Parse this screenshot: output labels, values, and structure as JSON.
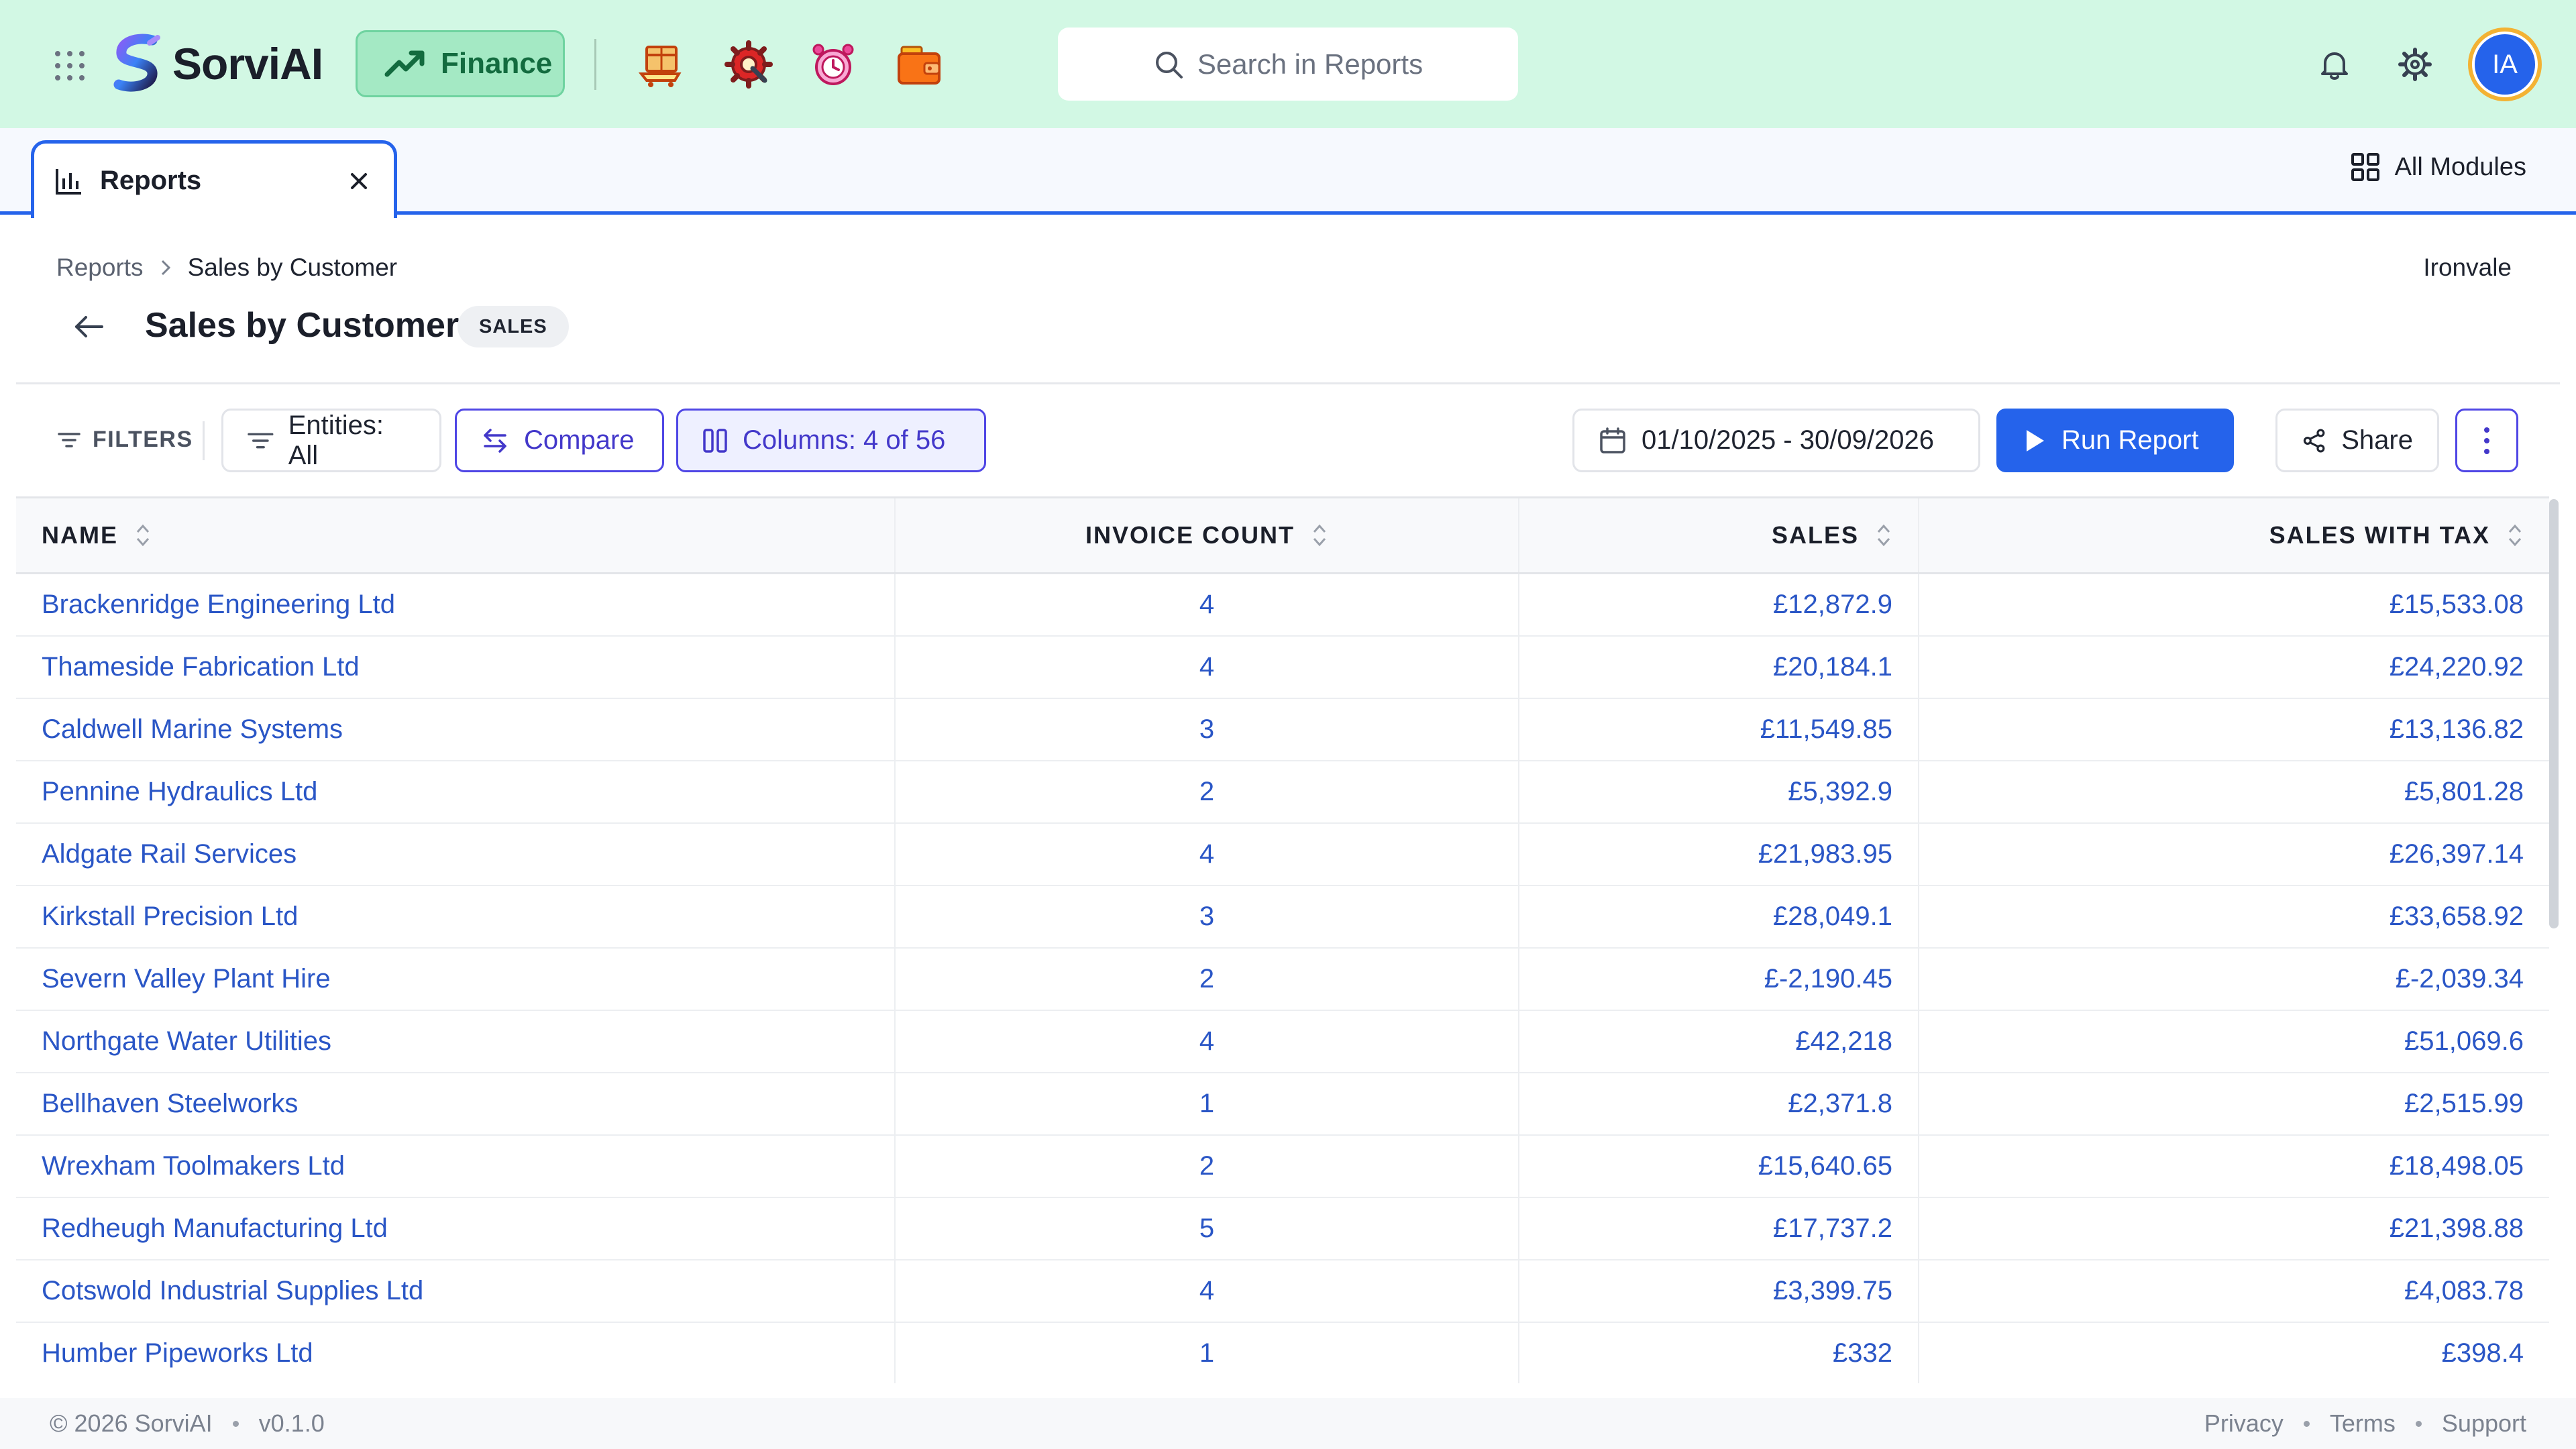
{
  "app": {
    "brand": "SorviAI",
    "module": "Finance",
    "search_placeholder": "Search in Reports",
    "user_initials": "IA",
    "icons": [
      "apps-grid-icon",
      "trend-up-icon",
      "box-cart-icon",
      "gear-wrench-icon",
      "alarm-clock-icon",
      "wallet-icon",
      "bell-icon",
      "settings-icon"
    ]
  },
  "tabs": {
    "active": {
      "label": "Reports"
    },
    "all_modules_label": "All Modules"
  },
  "page": {
    "breadcrumb": [
      "Reports",
      "Sales by Customer"
    ],
    "org_name": "Ironvale",
    "title": "Sales by Customer",
    "badge": "SALES"
  },
  "toolbar": {
    "filters_label": "FILTERS",
    "entities_label": "Entities: All",
    "compare_label": "Compare",
    "columns_label": "Columns: 4 of 56",
    "date_range": "01/10/2025 - 30/09/2026",
    "run_label": "Run Report",
    "share_label": "Share"
  },
  "colors": {
    "topbar_bg": "#d2f8e4",
    "accent_blue": "#2563eb",
    "accent_indigo": "#4f46e5",
    "link_blue": "#2a56c6",
    "finance_green": "#136b3f"
  },
  "table": {
    "columns": [
      "NAME",
      "INVOICE COUNT",
      "SALES",
      "SALES WITH TAX"
    ],
    "rows": [
      {
        "name": "Brackenridge Engineering Ltd",
        "invoice_count": "4",
        "sales": "£12,872.9",
        "sales_with_tax": "£15,533.08"
      },
      {
        "name": "Thameside Fabrication Ltd",
        "invoice_count": "4",
        "sales": "£20,184.1",
        "sales_with_tax": "£24,220.92"
      },
      {
        "name": "Caldwell Marine Systems",
        "invoice_count": "3",
        "sales": "£11,549.85",
        "sales_with_tax": "£13,136.82"
      },
      {
        "name": "Pennine Hydraulics Ltd",
        "invoice_count": "2",
        "sales": "£5,392.9",
        "sales_with_tax": "£5,801.28"
      },
      {
        "name": "Aldgate Rail Services",
        "invoice_count": "4",
        "sales": "£21,983.95",
        "sales_with_tax": "£26,397.14"
      },
      {
        "name": "Kirkstall Precision Ltd",
        "invoice_count": "3",
        "sales": "£28,049.1",
        "sales_with_tax": "£33,658.92"
      },
      {
        "name": "Severn Valley Plant Hire",
        "invoice_count": "2",
        "sales": "£-2,190.45",
        "sales_with_tax": "£-2,039.34"
      },
      {
        "name": "Northgate Water Utilities",
        "invoice_count": "4",
        "sales": "£42,218",
        "sales_with_tax": "£51,069.6"
      },
      {
        "name": "Bellhaven Steelworks",
        "invoice_count": "1",
        "sales": "£2,371.8",
        "sales_with_tax": "£2,515.99"
      },
      {
        "name": "Wrexham Toolmakers Ltd",
        "invoice_count": "2",
        "sales": "£15,640.65",
        "sales_with_tax": "£18,498.05"
      },
      {
        "name": "Redheugh Manufacturing Ltd",
        "invoice_count": "5",
        "sales": "£17,737.2",
        "sales_with_tax": "£21,398.88"
      },
      {
        "name": "Cotswold Industrial Supplies Ltd",
        "invoice_count": "4",
        "sales": "£3,399.75",
        "sales_with_tax": "£4,083.78"
      },
      {
        "name": "Humber Pipeworks Ltd",
        "invoice_count": "1",
        "sales": "£332",
        "sales_with_tax": "£398.4"
      }
    ]
  },
  "footer": {
    "copyright": "© 2026 SorviAI",
    "version": "v0.1.0",
    "links": [
      "Privacy",
      "Terms",
      "Support"
    ]
  }
}
